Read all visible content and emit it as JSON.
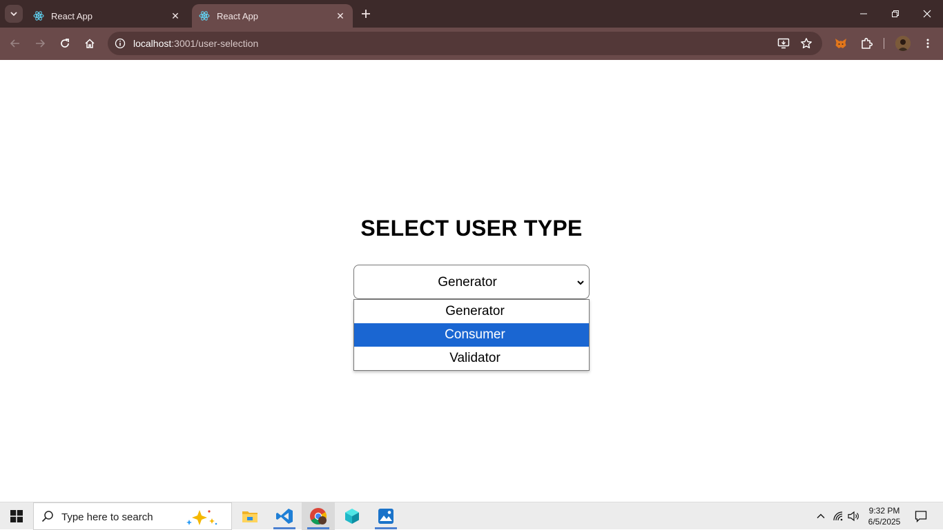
{
  "browser": {
    "tabs": [
      {
        "title": "React App",
        "active": false
      },
      {
        "title": "React App",
        "active": true
      }
    ],
    "address_bar": {
      "host": "localhost",
      "path": ":3001/user-selection"
    }
  },
  "page": {
    "title": "SELECT USER TYPE",
    "select": {
      "value": "Generator",
      "options": [
        "Generator",
        "Consumer",
        "Validator"
      ],
      "highlighted_option": "Consumer"
    }
  },
  "taskbar": {
    "search_placeholder": "Type here to search",
    "clock": {
      "time": "9:32 PM",
      "date": "6/5/2025"
    }
  },
  "colors": {
    "tabstrip": "#3d2a2a",
    "toolbar": "#6a4a4a",
    "highlight": "#1a66d2"
  }
}
